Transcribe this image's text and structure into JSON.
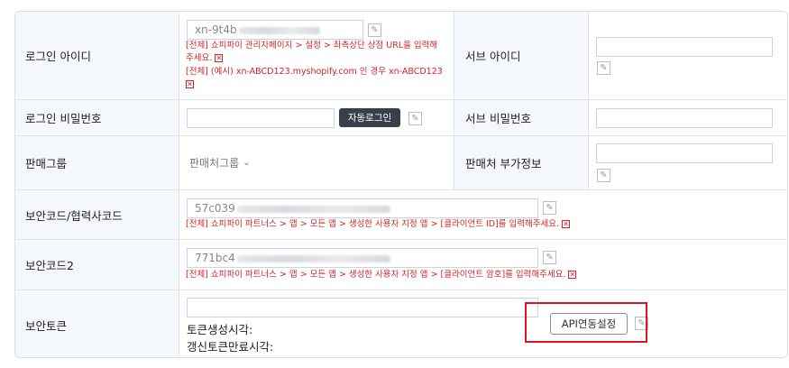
{
  "rows": {
    "login_id": {
      "label": "로그인 아이디",
      "value": "xn-9t4b",
      "note1_line1": "[전체] 쇼피파이 관리자페이지 > 설정 > 좌측상단 상점 URL을 입력해",
      "note1_line2": "주세요.",
      "note2": "[전체] (예시) xn-ABCD123.myshopify.com 인 경우 xn-ABCD123",
      "sub_label": "서브 아이디",
      "sub_value": ""
    },
    "login_pw": {
      "label": "로그인 비밀번호",
      "value": "",
      "auto_login_button": "자동로그인",
      "sub_label": "서브 비밀번호",
      "sub_value": ""
    },
    "seller_group": {
      "label": "판매그룹",
      "selected": "판매처그룹",
      "sub_label": "판매처 부가정보",
      "sub_value": ""
    },
    "security_code": {
      "label": "보안코드/협력사코드",
      "value": "57c039",
      "note": "[전체] 쇼피파이 파트너스 > 앱 > 모든 앱 > 생성한 사용자 지정 앱 > [클라이언트 ID]를 입력해주세요."
    },
    "security_code2": {
      "label": "보안코드2",
      "value": "771bc4",
      "note": "[전체] 쇼피파이 파트너스 > 앱 > 모든 앱 > 생성한 사용자 지정 앱 > [클라이언트 암호]를 입력해주세요."
    },
    "security_token": {
      "label": "보안토큰",
      "value": "",
      "token_created": "토큰생성시각:",
      "refresh_expire": "갱신토큰만료시각:",
      "api_button": "API연동설정"
    }
  },
  "icons": {
    "edit": "pencil-icon",
    "remove": "x-box-icon",
    "dropdown": "chevron-down-icon"
  },
  "colors": {
    "label_bg": "#f4f7fc",
    "note_red": "#d2232a",
    "highlight_red": "#e0141e",
    "dark_button": "#38404b"
  }
}
